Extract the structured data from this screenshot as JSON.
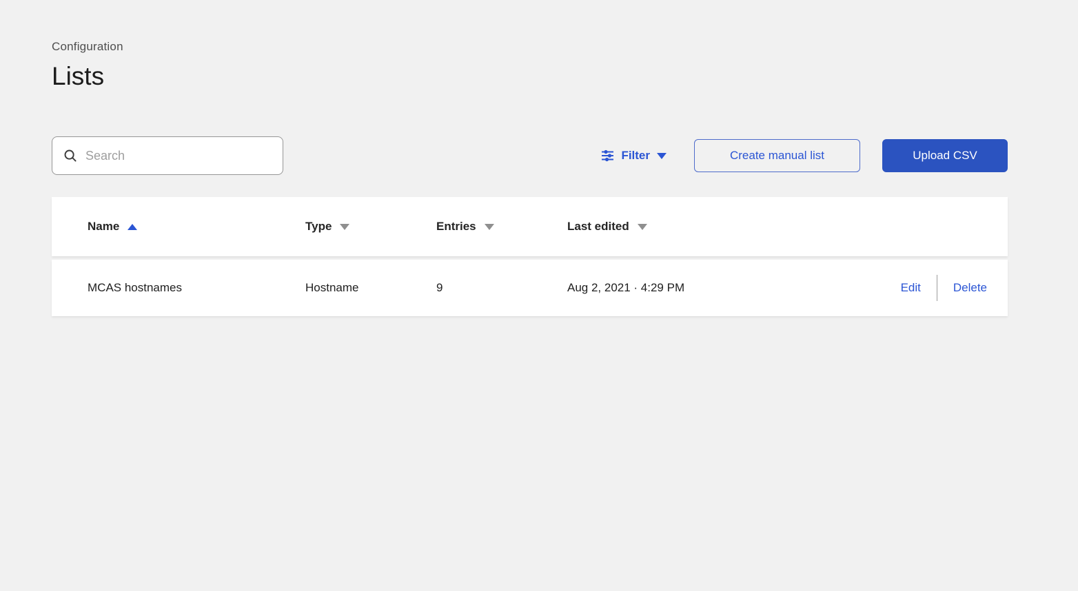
{
  "page": {
    "eyebrow": "Configuration",
    "title": "Lists"
  },
  "toolbar": {
    "search_placeholder": "Search",
    "filter_label": "Filter",
    "create_button": "Create manual list",
    "upload_button": "Upload CSV"
  },
  "table": {
    "columns": [
      {
        "label": "Name",
        "sort": "asc"
      },
      {
        "label": "Type",
        "sort": "none"
      },
      {
        "label": "Entries",
        "sort": "none"
      },
      {
        "label": "Last edited",
        "sort": "none"
      }
    ],
    "rows": [
      {
        "name": "MCAS hostnames",
        "type": "Hostname",
        "entries": "9",
        "last_edited": "Aug 2, 2021 · 4:29 PM",
        "actions": {
          "edit": "Edit",
          "delete": "Delete"
        }
      }
    ]
  },
  "icons": {
    "search": "search-icon",
    "filter": "filter-sliders-icon",
    "sort_asc": "caret-up-icon",
    "sort_desc": "caret-down-icon"
  },
  "colors": {
    "background": "#f1f1f1",
    "surface": "#ffffff",
    "primary_button_blue": "#2b53c0",
    "link_blue": "#2b55d4",
    "outline_button_border": "#4d6bcb",
    "heading_text": "#1c1c1c",
    "eyebrow_text": "#4e4e4e",
    "muted_caret_gray": "#8f8f8f",
    "search_border": "#969696",
    "placeholder_gray": "#9e9e9e"
  }
}
